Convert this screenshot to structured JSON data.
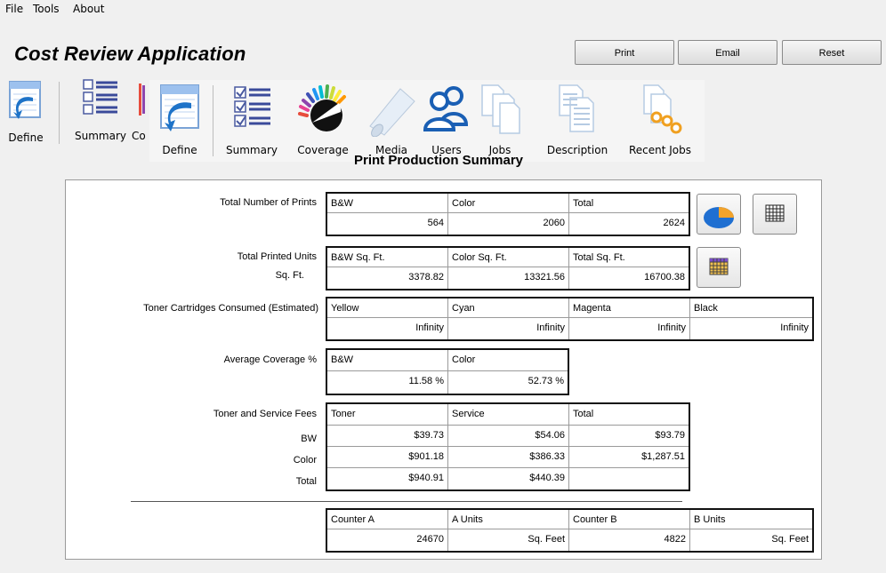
{
  "menu": [
    "File",
    "Tools",
    "About"
  ],
  "app_title": "Cost Review Application",
  "buttons": {
    "print": "Print",
    "email": "Email",
    "reset": "Reset"
  },
  "toolbar_back": {
    "define": "Define",
    "summary": "Summary",
    "cut": "Co"
  },
  "toolbar": {
    "define": "Define",
    "summary": "Summary",
    "coverage": "Coverage",
    "media": "Media",
    "users": "Users",
    "jobs": "Jobs",
    "description": "Description",
    "recent_jobs": "Recent Jobs"
  },
  "section_title": "Print Production Summary",
  "prints": {
    "label": "Total Number of Prints",
    "headers": [
      "B&W",
      "Color",
      "Total"
    ],
    "values": [
      "564",
      "2060",
      "2624"
    ]
  },
  "units": {
    "label": "Total Printed Units",
    "sublabel": "Sq. Ft.",
    "headers": [
      "B&W Sq. Ft.",
      "Color Sq. Ft.",
      "Total Sq. Ft."
    ],
    "values": [
      "3378.82",
      "13321.56",
      "16700.38"
    ]
  },
  "toner": {
    "label": "Toner Cartridges Consumed  (Estimated)",
    "headers": [
      "Yellow",
      "Cyan",
      "Magenta",
      "Black"
    ],
    "values": [
      "Infinity",
      "Infinity",
      "Infinity",
      "Infinity"
    ]
  },
  "coverage": {
    "label": "Average Coverage %",
    "headers": [
      "B&W",
      "Color"
    ],
    "values": [
      "11.58 %",
      "52.73 %"
    ]
  },
  "fees": {
    "label": "Toner and Service Fees",
    "row_labels": [
      "BW",
      "Color",
      "Total"
    ],
    "headers": [
      "Toner",
      "Service",
      "Total"
    ],
    "rows": [
      [
        "$39.73",
        "$54.06",
        "$93.79"
      ],
      [
        "$901.18",
        "$386.33",
        "$1,287.51"
      ],
      [
        "$940.91",
        "$440.39",
        ""
      ]
    ]
  },
  "counters": {
    "headers": [
      "Counter A",
      "A Units",
      "Counter B",
      "B Units"
    ],
    "values": [
      "24670",
      "Sq. Feet",
      "4822",
      "Sq. Feet"
    ]
  },
  "colors": {
    "pie_blue": "#1f6fd1",
    "pie_orange": "#f2a32b",
    "grid_border": "#111111"
  }
}
